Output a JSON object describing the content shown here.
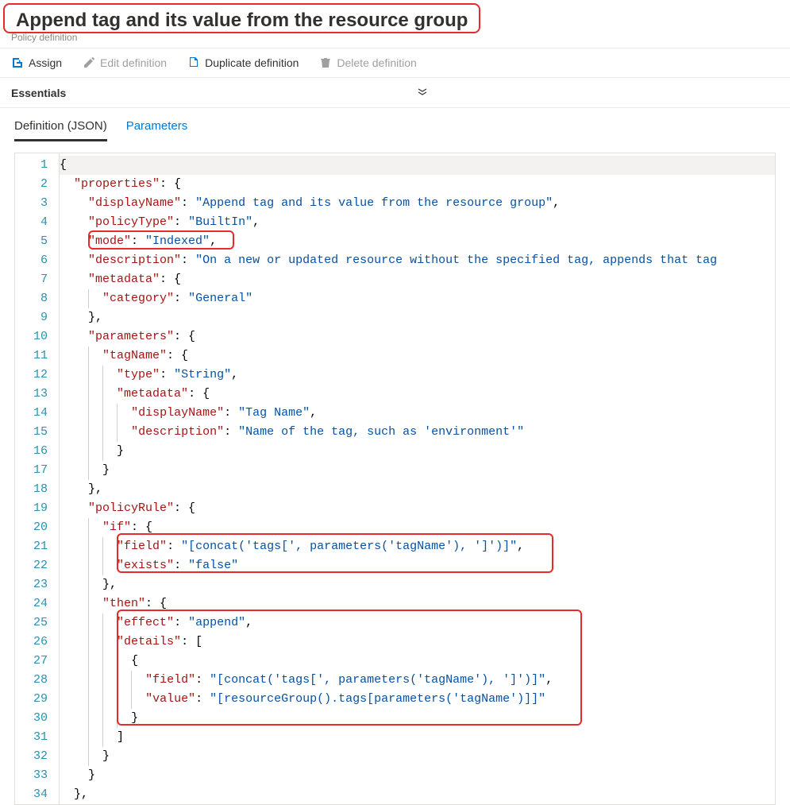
{
  "title": "Append tag and its value from the resource group",
  "subtitle": "Policy definition",
  "toolbar": {
    "assign": "Assign",
    "edit": "Edit definition",
    "duplicate": "Duplicate definition",
    "delete": "Delete definition"
  },
  "essentials_label": "Essentials",
  "tabs": {
    "definition": "Definition (JSON)",
    "parameters": "Parameters"
  },
  "code_tokens": {
    "properties": "\"properties\"",
    "displayName": "\"displayName\"",
    "displayName_val": "\"Append tag and its value from the resource group\"",
    "policyType": "\"policyType\"",
    "policyType_val": "\"BuiltIn\"",
    "mode": "\"mode\"",
    "mode_val": "\"Indexed\"",
    "description": "\"description\"",
    "description_val": "\"On a new or updated resource without the specified tag, appends that tag ",
    "metadata": "\"metadata\"",
    "category": "\"category\"",
    "category_val": "\"General\"",
    "parameters": "\"parameters\"",
    "tagName": "\"tagName\"",
    "type": "\"type\"",
    "type_val": "\"String\"",
    "param_displayName_val": "\"Tag Name\"",
    "param_description_val": "\"Name of the tag, such as 'environment'\"",
    "policyRule": "\"policyRule\"",
    "if": "\"if\"",
    "field": "\"field\"",
    "field_val": "\"[concat('tags[', parameters('tagName'), ']')]\"",
    "exists": "\"exists\"",
    "exists_val": "\"false\"",
    "then": "\"then\"",
    "effect": "\"effect\"",
    "effect_val": "\"append\"",
    "details": "\"details\"",
    "value": "\"value\"",
    "value_val": "\"[resourceGroup().tags[parameters('tagName')]]\""
  }
}
